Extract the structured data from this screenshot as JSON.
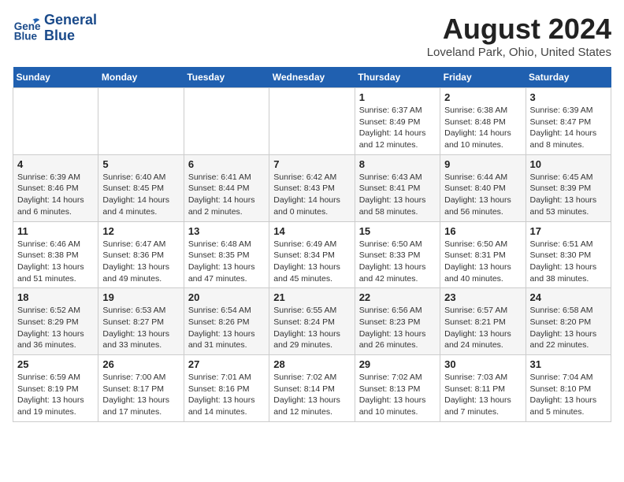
{
  "logo": {
    "line1": "General",
    "line2": "Blue"
  },
  "title": "August 2024",
  "subtitle": "Loveland Park, Ohio, United States",
  "days_of_week": [
    "Sunday",
    "Monday",
    "Tuesday",
    "Wednesday",
    "Thursday",
    "Friday",
    "Saturday"
  ],
  "weeks": [
    [
      {
        "day": "",
        "detail": ""
      },
      {
        "day": "",
        "detail": ""
      },
      {
        "day": "",
        "detail": ""
      },
      {
        "day": "",
        "detail": ""
      },
      {
        "day": "1",
        "detail": "Sunrise: 6:37 AM\nSunset: 8:49 PM\nDaylight: 14 hours\nand 12 minutes."
      },
      {
        "day": "2",
        "detail": "Sunrise: 6:38 AM\nSunset: 8:48 PM\nDaylight: 14 hours\nand 10 minutes."
      },
      {
        "day": "3",
        "detail": "Sunrise: 6:39 AM\nSunset: 8:47 PM\nDaylight: 14 hours\nand 8 minutes."
      }
    ],
    [
      {
        "day": "4",
        "detail": "Sunrise: 6:39 AM\nSunset: 8:46 PM\nDaylight: 14 hours\nand 6 minutes."
      },
      {
        "day": "5",
        "detail": "Sunrise: 6:40 AM\nSunset: 8:45 PM\nDaylight: 14 hours\nand 4 minutes."
      },
      {
        "day": "6",
        "detail": "Sunrise: 6:41 AM\nSunset: 8:44 PM\nDaylight: 14 hours\nand 2 minutes."
      },
      {
        "day": "7",
        "detail": "Sunrise: 6:42 AM\nSunset: 8:43 PM\nDaylight: 14 hours\nand 0 minutes."
      },
      {
        "day": "8",
        "detail": "Sunrise: 6:43 AM\nSunset: 8:41 PM\nDaylight: 13 hours\nand 58 minutes."
      },
      {
        "day": "9",
        "detail": "Sunrise: 6:44 AM\nSunset: 8:40 PM\nDaylight: 13 hours\nand 56 minutes."
      },
      {
        "day": "10",
        "detail": "Sunrise: 6:45 AM\nSunset: 8:39 PM\nDaylight: 13 hours\nand 53 minutes."
      }
    ],
    [
      {
        "day": "11",
        "detail": "Sunrise: 6:46 AM\nSunset: 8:38 PM\nDaylight: 13 hours\nand 51 minutes."
      },
      {
        "day": "12",
        "detail": "Sunrise: 6:47 AM\nSunset: 8:36 PM\nDaylight: 13 hours\nand 49 minutes."
      },
      {
        "day": "13",
        "detail": "Sunrise: 6:48 AM\nSunset: 8:35 PM\nDaylight: 13 hours\nand 47 minutes."
      },
      {
        "day": "14",
        "detail": "Sunrise: 6:49 AM\nSunset: 8:34 PM\nDaylight: 13 hours\nand 45 minutes."
      },
      {
        "day": "15",
        "detail": "Sunrise: 6:50 AM\nSunset: 8:33 PM\nDaylight: 13 hours\nand 42 minutes."
      },
      {
        "day": "16",
        "detail": "Sunrise: 6:50 AM\nSunset: 8:31 PM\nDaylight: 13 hours\nand 40 minutes."
      },
      {
        "day": "17",
        "detail": "Sunrise: 6:51 AM\nSunset: 8:30 PM\nDaylight: 13 hours\nand 38 minutes."
      }
    ],
    [
      {
        "day": "18",
        "detail": "Sunrise: 6:52 AM\nSunset: 8:29 PM\nDaylight: 13 hours\nand 36 minutes."
      },
      {
        "day": "19",
        "detail": "Sunrise: 6:53 AM\nSunset: 8:27 PM\nDaylight: 13 hours\nand 33 minutes."
      },
      {
        "day": "20",
        "detail": "Sunrise: 6:54 AM\nSunset: 8:26 PM\nDaylight: 13 hours\nand 31 minutes."
      },
      {
        "day": "21",
        "detail": "Sunrise: 6:55 AM\nSunset: 8:24 PM\nDaylight: 13 hours\nand 29 minutes."
      },
      {
        "day": "22",
        "detail": "Sunrise: 6:56 AM\nSunset: 8:23 PM\nDaylight: 13 hours\nand 26 minutes."
      },
      {
        "day": "23",
        "detail": "Sunrise: 6:57 AM\nSunset: 8:21 PM\nDaylight: 13 hours\nand 24 minutes."
      },
      {
        "day": "24",
        "detail": "Sunrise: 6:58 AM\nSunset: 8:20 PM\nDaylight: 13 hours\nand 22 minutes."
      }
    ],
    [
      {
        "day": "25",
        "detail": "Sunrise: 6:59 AM\nSunset: 8:19 PM\nDaylight: 13 hours\nand 19 minutes."
      },
      {
        "day": "26",
        "detail": "Sunrise: 7:00 AM\nSunset: 8:17 PM\nDaylight: 13 hours\nand 17 minutes."
      },
      {
        "day": "27",
        "detail": "Sunrise: 7:01 AM\nSunset: 8:16 PM\nDaylight: 13 hours\nand 14 minutes."
      },
      {
        "day": "28",
        "detail": "Sunrise: 7:02 AM\nSunset: 8:14 PM\nDaylight: 13 hours\nand 12 minutes."
      },
      {
        "day": "29",
        "detail": "Sunrise: 7:02 AM\nSunset: 8:13 PM\nDaylight: 13 hours\nand 10 minutes."
      },
      {
        "day": "30",
        "detail": "Sunrise: 7:03 AM\nSunset: 8:11 PM\nDaylight: 13 hours\nand 7 minutes."
      },
      {
        "day": "31",
        "detail": "Sunrise: 7:04 AM\nSunset: 8:10 PM\nDaylight: 13 hours\nand 5 minutes."
      }
    ]
  ]
}
